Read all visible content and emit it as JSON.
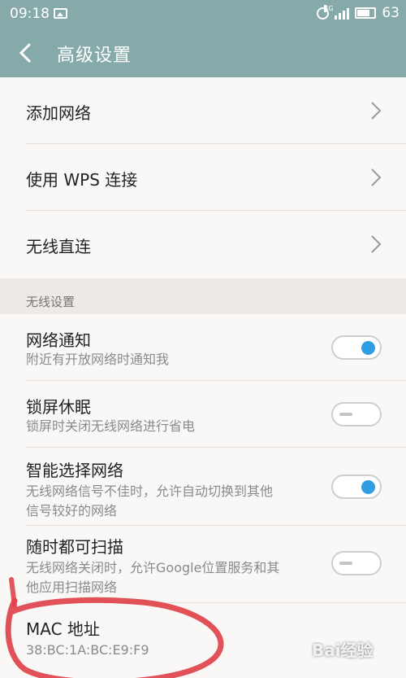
{
  "status_bar": {
    "time": "09:18",
    "network_type": "4G",
    "battery": "63",
    "icons": [
      "image-icon",
      "alarm-icon",
      "signal-icon",
      "battery-icon"
    ]
  },
  "header": {
    "title": "高级设置",
    "back_icon": "chevron-left-icon"
  },
  "nav_items": [
    {
      "label": "添加网络"
    },
    {
      "label": "使用 WPS 连接"
    },
    {
      "label": "无线直连"
    }
  ],
  "section": {
    "title": "无线设置"
  },
  "settings": [
    {
      "title": "网络通知",
      "subtitle": "附近有开放网络时通知我",
      "enabled": true
    },
    {
      "title": "锁屏休眠",
      "subtitle": "锁屏时关闭无线网络进行省电",
      "enabled": false
    },
    {
      "title": "智能选择网络",
      "subtitle_line1": "无线网络信号不佳时，允许自动切换到其他",
      "subtitle_line2": "信号较好的网络",
      "enabled": true
    },
    {
      "title": "随时都可扫描",
      "subtitle_line1": "无线网络关闭时，允许Google位置服务和其",
      "subtitle_line2": "他应用扫描网络",
      "enabled": false
    }
  ],
  "mac": {
    "title": "MAC 地址",
    "value": "38:BC:1A:BC:E9:F9"
  },
  "colors": {
    "accent": "#2f9ee4",
    "header": "#86a9a9",
    "annotation": "#e0414a"
  },
  "watermark": "Bai经验"
}
